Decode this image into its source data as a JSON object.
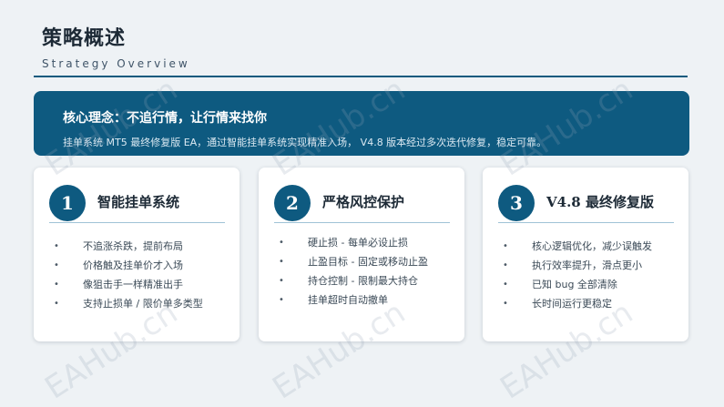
{
  "header": {
    "title": "策略概述",
    "subtitle": "Strategy Overview"
  },
  "banner": {
    "title": "核心理念：不追行情，让行情来找你",
    "description": "挂单系统 MT5 最终修复版 EA，通过智能挂单系统实现精准入场， V4.8 版本经过多次迭代修复，稳定可靠。"
  },
  "cards": [
    {
      "number": "1",
      "title": "智能挂单系统",
      "items": [
        "不追涨杀跌，提前布局",
        "价格触及挂单价才入场",
        "像狙击手一样精准出手",
        "支持止损单 / 限价单多类型"
      ]
    },
    {
      "number": "2",
      "title": "严格风控保护",
      "items": [
        "硬止损 - 每单必设止损",
        "止盈目标 - 固定或移动止盈",
        "持仓控制 - 限制最大持仓",
        "挂单超时自动撤单"
      ]
    },
    {
      "number": "3",
      "title": "V4.8 最终修复版",
      "items": [
        "核心逻辑优化，减少误触发",
        "执行效率提升，滑点更小",
        "已知 bug 全部清除",
        "长时间运行更稳定"
      ]
    }
  ],
  "watermark": "EAHub.cn",
  "colors": {
    "primary": "#0e5a80",
    "background": "#eef2f5",
    "card": "#ffffff"
  }
}
